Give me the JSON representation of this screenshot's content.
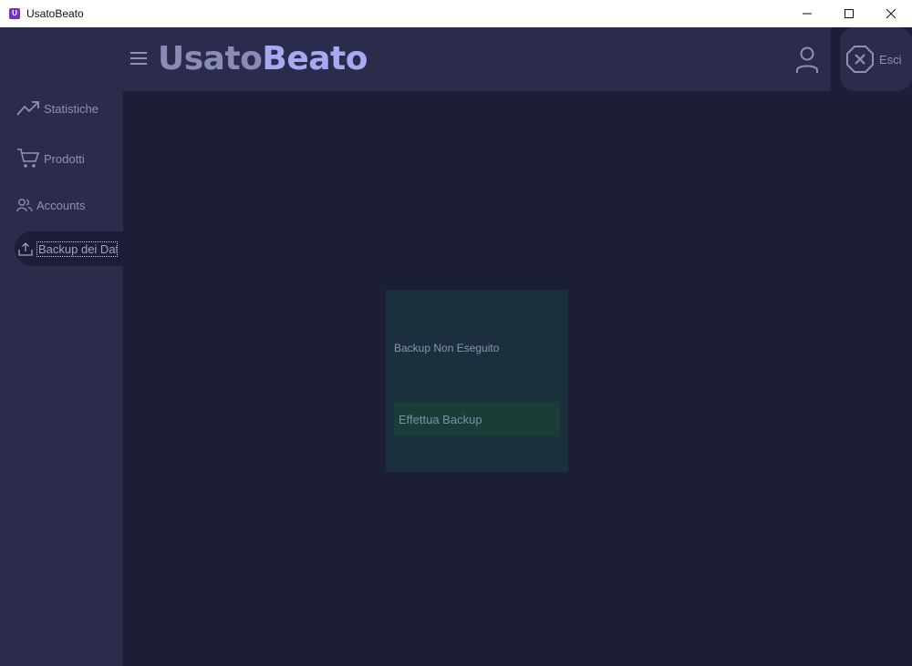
{
  "window": {
    "title": "UsatoBeato",
    "app_icon_letter": "U"
  },
  "header": {
    "brand_part1": "Usato",
    "brand_part2": "Beato"
  },
  "exit": {
    "label": "Esci"
  },
  "sidebar": {
    "items": [
      {
        "label": "Statistiche",
        "icon": "trending-up-icon"
      },
      {
        "label": "Prodotti",
        "icon": "cart-icon"
      },
      {
        "label": "Accounts",
        "icon": "users-icon"
      },
      {
        "label": "Backup dei Dati",
        "icon": "upload-icon",
        "active": true
      }
    ]
  },
  "backup": {
    "status": "Backup Non Eseguito",
    "button_label": "Effettua Backup"
  },
  "colors": {
    "sidebar_bg": "#2b2c4b",
    "main_bg": "#1c1e37",
    "brand_accent": "#a8a9f2",
    "card_bg": "#1c2f3d",
    "button_bg": "#1b3d38"
  }
}
